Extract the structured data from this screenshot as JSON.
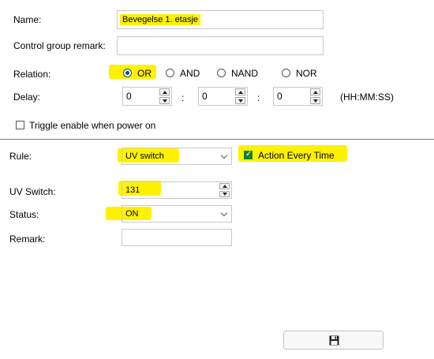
{
  "group": {
    "name_label": "Name:",
    "name_value": "Bevegelse 1. etasje",
    "remark_label": "Control group remark:",
    "remark_value": "",
    "relation_label": "Relation:",
    "relation_options": [
      "OR",
      "AND",
      "NAND",
      "NOR"
    ],
    "relation_selected": "OR",
    "delay_label": "Delay:",
    "delay_values": [
      "0",
      "0",
      "0"
    ],
    "delay_separator": ":",
    "delay_format": "(HH:MM:SS)",
    "triggle_label": "Triggle enable when power on",
    "triggle_checked": false
  },
  "rule": {
    "rule_label": "Rule:",
    "rule_value": "UV switch",
    "action_label": "Action Every Time",
    "action_checked": true,
    "uv_label": "UV Switch:",
    "uv_value": "131",
    "status_label": "Status:",
    "status_value": "ON",
    "remark_label": "Remark:",
    "remark_value": ""
  },
  "footer": {
    "save_icon": "floppy-disk-icon"
  },
  "colors": {
    "highlight": "#fff200",
    "radio_accent": "#0b4f8a",
    "checkbox_accent": "#1a7f33",
    "divider": "#7a7a7a"
  }
}
